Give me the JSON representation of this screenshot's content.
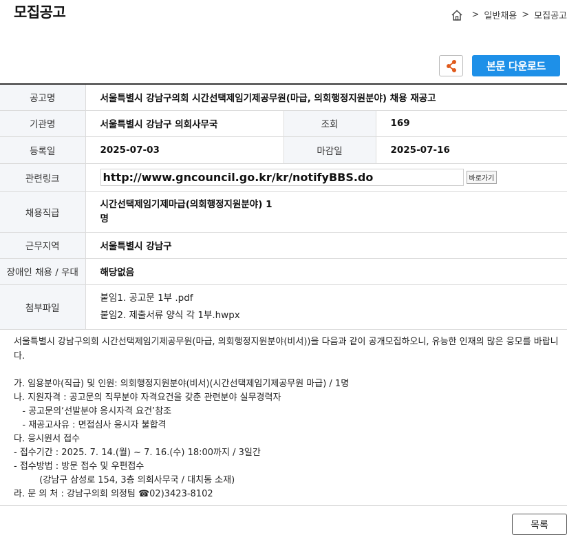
{
  "page": {
    "title": "모집공고"
  },
  "breadcrumb": {
    "sep1": ">",
    "item1": "일반채용",
    "sep2": ">",
    "item2": "모집공고"
  },
  "toolbar": {
    "download_label": "본문 다운로드"
  },
  "info": {
    "notice_label": "공고명",
    "notice_value": "서울특별시 강남구의회 시간선택제임기제공무원(마급, 의회행정지원분야) 채용 재공고",
    "agency_label": "기관명",
    "agency_value": "서울특별시 강남구 의회사무국",
    "views_label": "조회",
    "views_value": "169",
    "registered_label": "등록일",
    "registered_value": "2025-07-03",
    "deadline_label": "마감일",
    "deadline_value": "2025-07-16",
    "link_label": "관련링크",
    "link_value": "http://www.gncouncil.go.kr/kr/notifyBBS.do",
    "goto_label": "바로가기",
    "position_label": "채용직급",
    "position_value": "시간선택제임기제마급(의회행정지원분야) 1명",
    "location_label": "근무지역",
    "location_value": "서울특별시 강남구",
    "disability_label": "장애인 채용 / 우대",
    "disability_value": "해당없음",
    "attachments_label": "첨부파일",
    "attachments": [
      "붙임1. 공고문 1부 .pdf",
      "붙임2. 제출서류 양식 각 1부.hwpx"
    ]
  },
  "content": {
    "intro": "서울특별시 강남구의회 시간선택제임기제공무원(마급, 의회행정지원분야(비서))을 다음과 같이 공개모집하오니, 유능한 인재의 많은 응모를 바랍니다.",
    "lines": [
      "가. 임용분야(직급) 및 인원: 의회행정지원분야(비서)(시간선택제임기제공무원 마급) / 1명",
      "나. 지원자격 : 공고문의 직무분야 자격요건을 갖춘 관련분야 실무경력자",
      "   - 공고문의‘선발분야 응시자격 요건’참조",
      "   - 재공고사유 : 면접심사 응시자 불합격",
      "다. 응시원서 접수",
      "- 접수기간 : 2025. 7. 14.(월) ~ 7. 16.(수) 18:00까지 / 3일간",
      "- 접수방법 : 방문 접수 및 우편접수",
      "         (강남구 삼성로 154, 3층 의회사무국 / 대치동 소재)",
      "라. 문 의 처 : 강남구의회 의정팀 ☎02)3423-8102"
    ]
  },
  "footer": {
    "list_label": "목록"
  },
  "colors": {
    "accent": "#1e90e8",
    "header_bg": "#f4f6f9",
    "border": "#dcdcdc"
  },
  "icons": {
    "home": "home-icon",
    "share": "share-icon"
  }
}
